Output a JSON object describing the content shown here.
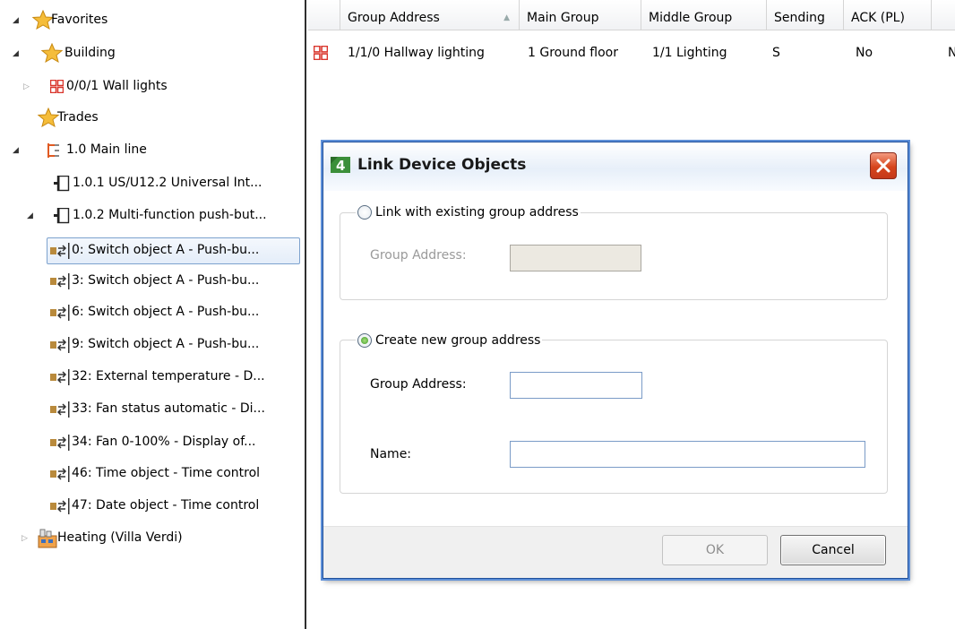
{
  "tree": {
    "items": [
      {
        "label": "Favorites",
        "icon": "star-icon"
      },
      {
        "label": "Building",
        "icon": "star-icon"
      },
      {
        "label": "0/0/1 Wall lights",
        "icon": "group-address-icon"
      },
      {
        "label": "Trades",
        "icon": "star-icon"
      },
      {
        "label": "1.0 Main line",
        "icon": "line-icon"
      },
      {
        "label": "1.0.1  US/U12.2 Universal Int...",
        "icon": "device-icon"
      },
      {
        "label": "1.0.2  Multi-function push-but...",
        "icon": "device-icon"
      },
      {
        "label": "0: Switch object A - Push-bu...",
        "icon": "communication-object-icon"
      },
      {
        "label": "3: Switch object A - Push-bu...",
        "icon": "communication-object-icon"
      },
      {
        "label": "6: Switch object A - Push-bu...",
        "icon": "communication-object-icon"
      },
      {
        "label": "9: Switch object A - Push-bu...",
        "icon": "communication-object-icon"
      },
      {
        "label": "32: External temperature - D...",
        "icon": "communication-object-icon"
      },
      {
        "label": "33: Fan status automatic - Di...",
        "icon": "communication-object-icon"
      },
      {
        "label": "34: Fan 0-100% - Display of...",
        "icon": "communication-object-icon"
      },
      {
        "label": "46: Time object - Time control",
        "icon": "communication-object-icon"
      },
      {
        "label": "47: Date object - Time control",
        "icon": "communication-object-icon"
      },
      {
        "label": "Heating (Villa Verdi)",
        "icon": "building-icon"
      }
    ]
  },
  "table": {
    "columns": [
      "Group Address",
      "Main Group",
      "Middle Group",
      "Sending",
      "ACK (PL)"
    ],
    "rows": [
      {
        "group_address": "1/1/0 Hallway lighting",
        "main_group": "1 Ground floor",
        "middle_group": "1/1 Lighting",
        "sending": "S",
        "ack": "No",
        "overflow": "N"
      }
    ]
  },
  "dialog": {
    "title": "Link Device Objects",
    "option_existing": "Link with existing group address",
    "existing_label": "Group Address:",
    "existing_value": "",
    "option_new": "Create new group address",
    "new_address_label": "Group Address:",
    "new_address_value": "",
    "name_label": "Name:",
    "name_value": "",
    "ok_label": "OK",
    "cancel_label": "Cancel"
  },
  "colors": {
    "star": "#f2b630",
    "group_address_icon": "#d9342b",
    "line_icon": "#e05a22",
    "dialog_border": "#1f4f9a",
    "close_button": "#d6451c"
  }
}
